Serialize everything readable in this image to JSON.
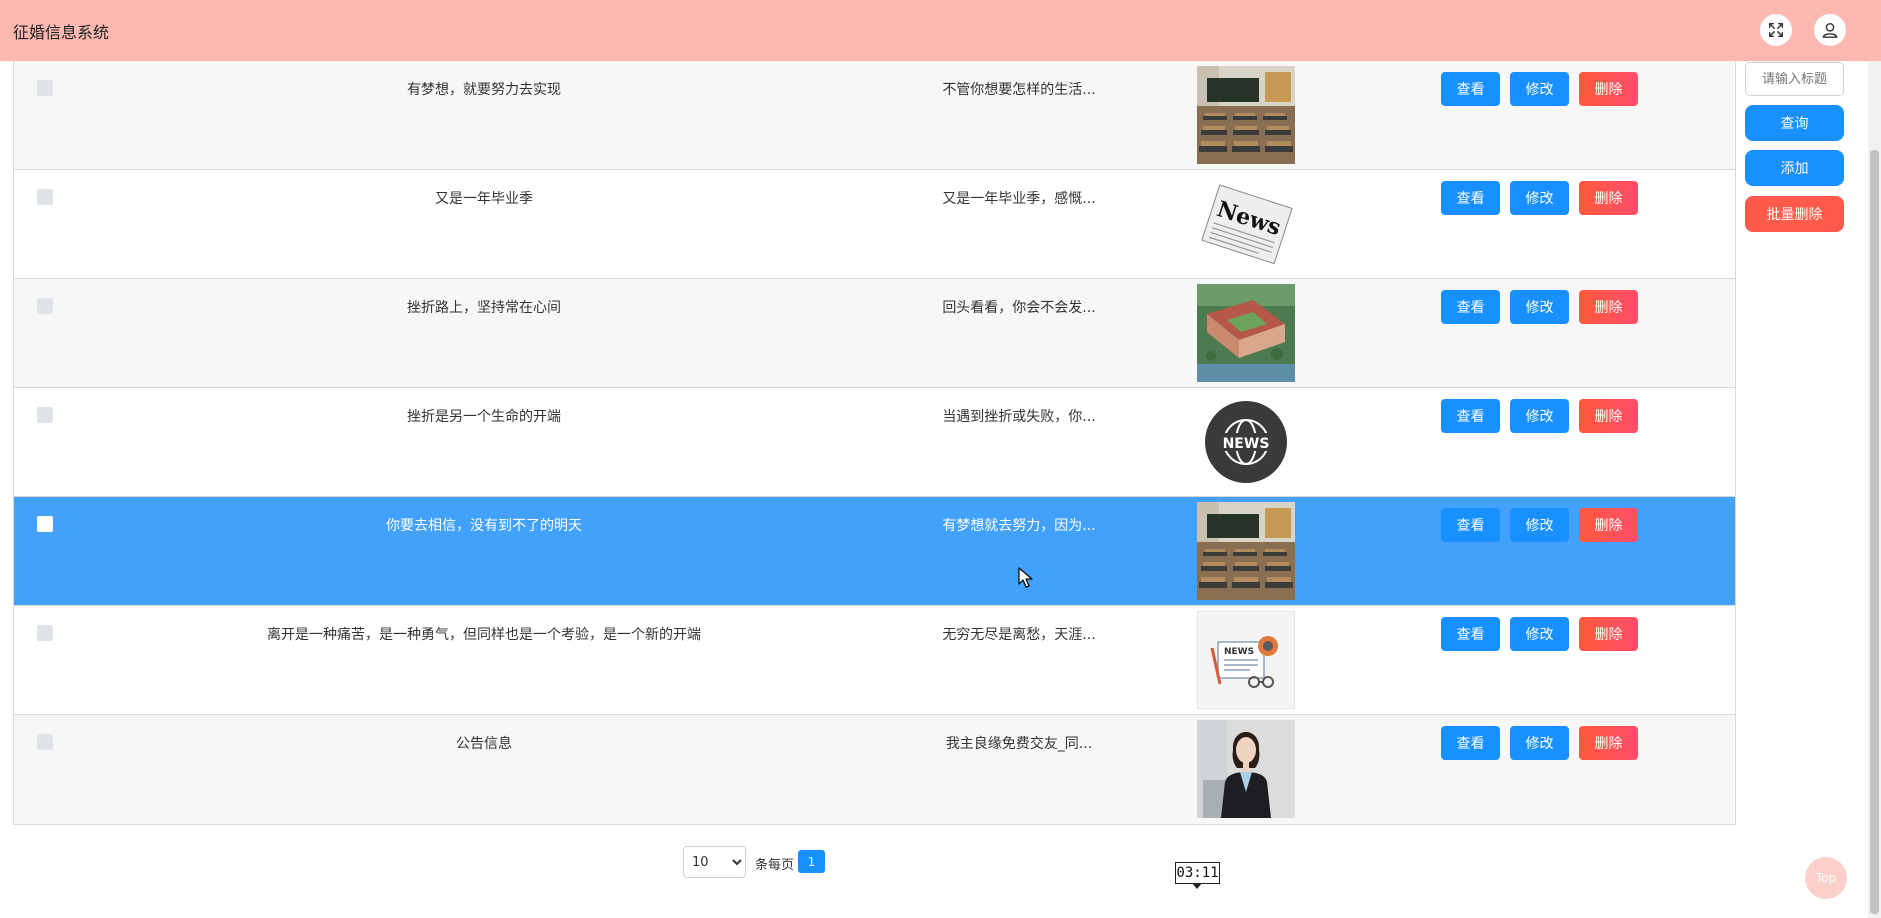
{
  "header": {
    "title": "征婚信息系统",
    "fullscreen_icon": "expand-icon",
    "user_icon": "user-icon",
    "bg_color": "#fbb8b0"
  },
  "table": {
    "rows": [
      {
        "title": "有梦想，就要努力去实现",
        "intro": "不管你想要怎样的生活...",
        "image": "classroom-image",
        "view": "查看",
        "edit": "修改",
        "delete": "删除"
      },
      {
        "title": "又是一年毕业季",
        "intro": "又是一年毕业季，感慨...",
        "image": "newspaper-image",
        "view": "查看",
        "edit": "修改",
        "delete": "删除"
      },
      {
        "title": "挫折路上，坚持常在心间",
        "intro": "回头看看，你会不会发...",
        "image": "campus-aerial-image",
        "view": "查看",
        "edit": "修改",
        "delete": "删除"
      },
      {
        "title": "挫折是另一个生命的开端",
        "intro": "当遇到挫折或失败，你...",
        "image": "news-globe-image",
        "view": "查看",
        "edit": "修改",
        "delete": "删除"
      },
      {
        "title": "你要去相信，没有到不了的明天",
        "intro": "有梦想就去努力，因为...",
        "image": "classroom-image",
        "view": "查看",
        "edit": "修改",
        "delete": "删除"
      },
      {
        "title": "离开是一种痛苦，是一种勇气，但同样也是一个考验，是一个新的开端",
        "intro": "无穷无尽是离愁，天涯...",
        "image": "news-paper-illustration",
        "view": "查看",
        "edit": "修改",
        "delete": "删除"
      },
      {
        "title": "公告信息",
        "intro": "我主良缘免费交友_同...",
        "image": "businesswoman-image",
        "view": "查看",
        "edit": "修改",
        "delete": "删除"
      }
    ]
  },
  "sidebar": {
    "search_placeholder": "请输入标题",
    "query_label": "查询",
    "add_label": "添加",
    "batch_delete_label": "批量删除"
  },
  "pagination": {
    "page_size": "10",
    "page_size_options": [
      "10"
    ],
    "per_page_label": "条每页",
    "current_page": "1"
  },
  "timer": {
    "text": "03:11"
  },
  "top_button": {
    "label": "Top"
  },
  "colors": {
    "primary": "#1890ff",
    "danger": "#ff5a4a",
    "selected_row": "#42a1fb"
  }
}
